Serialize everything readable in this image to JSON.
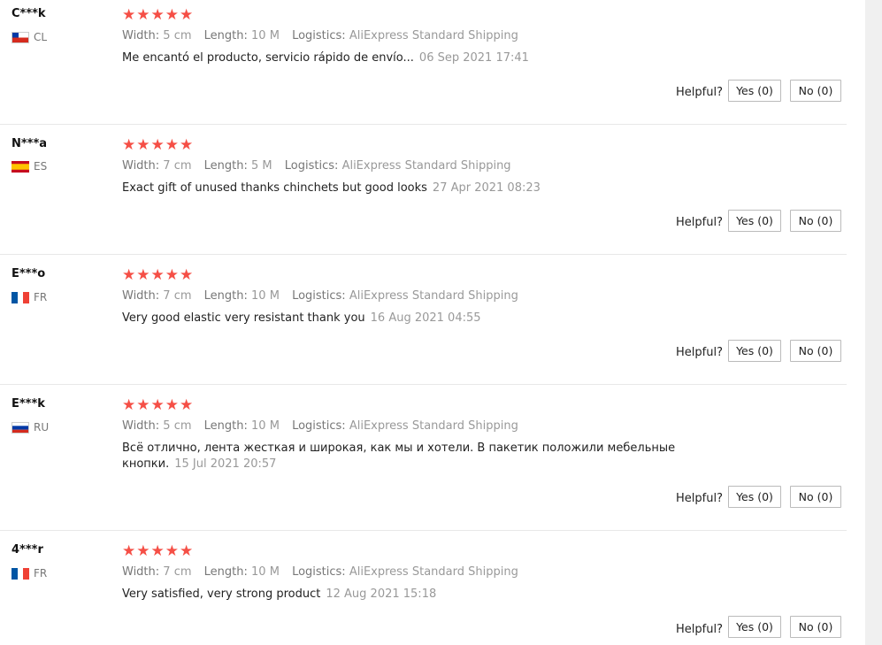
{
  "helpful_label": "Helpful?",
  "labels": {
    "width": "Width:",
    "length": "Length:",
    "logistics": "Logistics:"
  },
  "stars": "★★★★★",
  "reviews": [
    {
      "user": "C***k",
      "country": "CL",
      "width": "5 cm",
      "length": "10 M",
      "logistics": "AliExpress Standard Shipping",
      "text": "Me encantó el producto, servicio rápido de envío...",
      "date": "06 Sep 2021 17:41",
      "yes": "Yes (0)",
      "no": "No (0)"
    },
    {
      "user": "N***a",
      "country": "ES",
      "width": "7 cm",
      "length": "5 M",
      "logistics": "AliExpress Standard Shipping",
      "text": "Exact gift of unused thanks chinchets but good looks",
      "date": "27 Apr 2021 08:23",
      "yes": "Yes (0)",
      "no": "No (0)"
    },
    {
      "user": "E***o",
      "country": "FR",
      "width": "7 cm",
      "length": "10 M",
      "logistics": "AliExpress Standard Shipping",
      "text": "Very good elastic very resistant thank you",
      "date": "16 Aug 2021 04:55",
      "yes": "Yes (0)",
      "no": "No (0)"
    },
    {
      "user": "E***k",
      "country": "RU",
      "width": "5 cm",
      "length": "10 M",
      "logistics": "AliExpress Standard Shipping",
      "text": "Всё отлично, лента жесткая и широкая, как мы и хотели. В пакетик положили мебельные кнопки.",
      "date": "15 Jul 2021 20:57",
      "yes": "Yes (0)",
      "no": "No (0)"
    },
    {
      "user": "4***r",
      "country": "FR",
      "width": "7 cm",
      "length": "10 M",
      "logistics": "AliExpress Standard Shipping",
      "text": "Very satisfied, very strong product",
      "date": "12 Aug 2021 15:18",
      "yes": "Yes (0)",
      "no": "No (0)"
    }
  ]
}
